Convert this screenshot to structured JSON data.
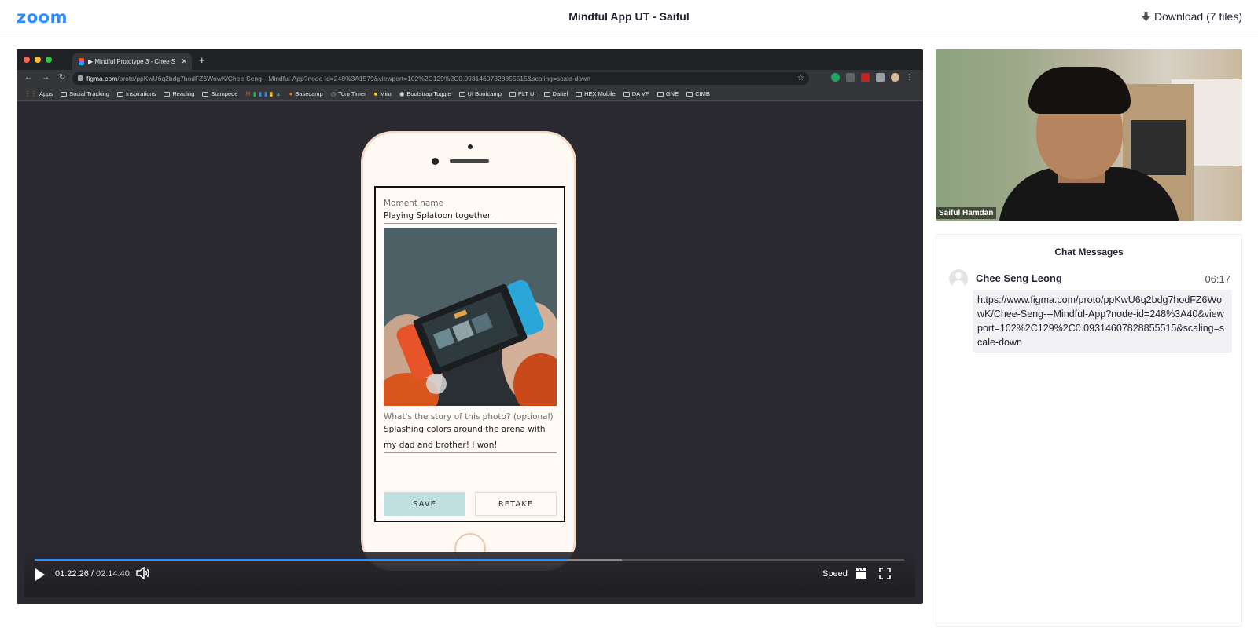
{
  "header": {
    "logo": "zoom",
    "title": "Mindful App UT - Saiful",
    "download_label": "Download (7 files)"
  },
  "browser": {
    "tab_title": "▶ Mindful Prototype 3 - Chee S",
    "url_host": "figma.com",
    "url_path": "/proto/ppKwU6q2bdg7hodFZ6WowK/Chee-Seng---Mindful-App?node-id=248%3A1579&viewport=102%2C129%2C0.09314607828855515&scaling=scale-down",
    "bookmarks": [
      "Apps",
      "Social Tracking",
      "Inspirations",
      "Reading",
      "Stampede",
      "Basecamp",
      "Toro Timer",
      "Miro",
      "Bootstrap Toggle",
      "UI Bootcamp",
      "PLT UI",
      "Dattel",
      "HEX Mobile",
      "DA VP",
      "GNE",
      "CIMB"
    ]
  },
  "prototype": {
    "moment_label": "Moment name",
    "moment_value": "Playing Splatoon together",
    "story_label": "What's the story of this photo? (optional)",
    "story_line1": "Splashing colors around the arena with",
    "story_line2": "my dad and brother! I won!",
    "save_label": "SAVE",
    "retake_label": "RETAKE"
  },
  "player": {
    "current_time": "01:22:26",
    "separator": "/",
    "duration": "02:14:40",
    "speed_label": "Speed",
    "progress_fraction": 0.612,
    "buffered_fraction": 0.675
  },
  "video": {
    "participant_name": "Saiful Hamdan"
  },
  "chat": {
    "title": "Chat Messages",
    "messages": [
      {
        "sender": "Chee Seng Leong",
        "time": "06:17",
        "text": "https://www.figma.com/proto/ppKwU6q2bdg7hodFZ6WowK/Chee-Seng---Mindful-App?node-id=248%3A40&viewport=102%2C129%2C0.09314607828855515&scaling=scale-down"
      }
    ]
  },
  "colors": {
    "accent": "#2d8cff",
    "save_button": "#bfe0df"
  }
}
